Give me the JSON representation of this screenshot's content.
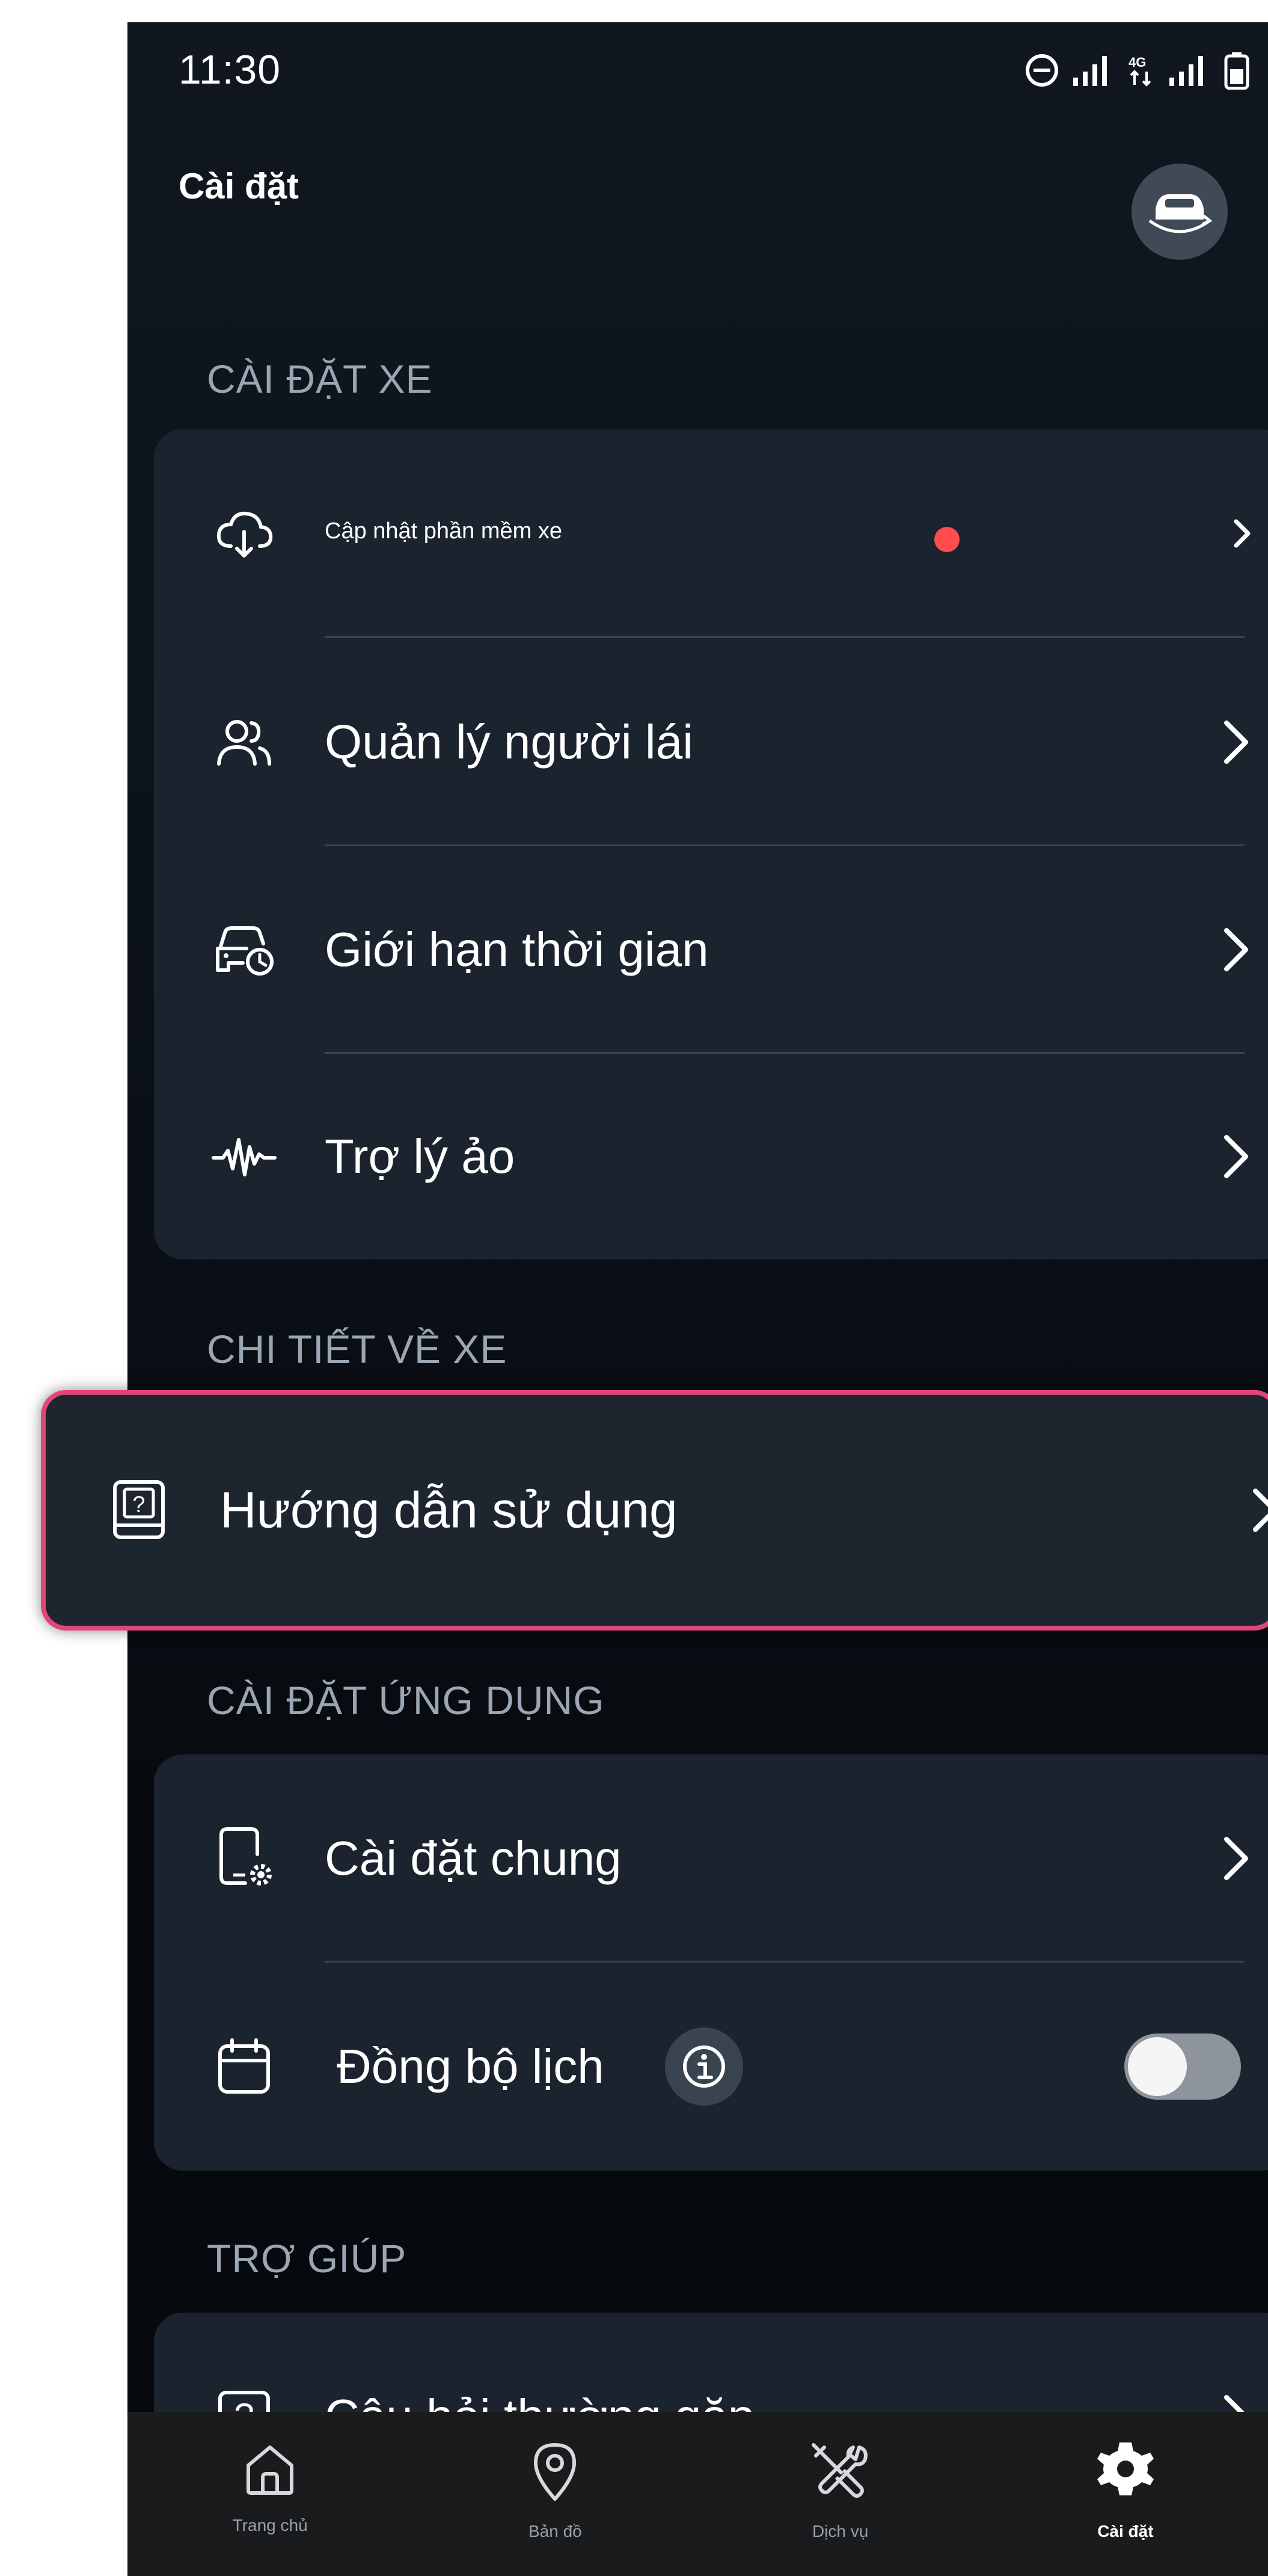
{
  "status_bar": {
    "time": "11:30",
    "signal_label": "4G"
  },
  "header": {
    "title": "Cài đặt"
  },
  "sections": {
    "vehicle_settings": {
      "label": "CÀI ĐẶT XE",
      "items": [
        {
          "label": "Cập nhật phần mềm xe",
          "icon": "cloud-download-icon"
        },
        {
          "label": "Quản lý người lái",
          "icon": "users-icon"
        },
        {
          "label": "Giới hạn thời gian",
          "icon": "car-clock-icon"
        },
        {
          "label": "Trợ lý ảo",
          "icon": "voice-wave-icon"
        }
      ]
    },
    "vehicle_details": {
      "label": "CHI TIẾT VỀ XE",
      "items": [
        {
          "label": "Hướng dẫn sử dụng",
          "icon": "manual-book-icon"
        }
      ]
    },
    "app_settings": {
      "label": "CÀI ĐẶT ỨNG DỤNG",
      "items": [
        {
          "label": "Cài đặt chung",
          "icon": "phone-settings-icon"
        },
        {
          "label": "Đồng bộ lịch",
          "icon": "calendar-icon",
          "toggle_on": false
        }
      ]
    },
    "help": {
      "label": "TRỢ GIÚP",
      "items": [
        {
          "label": "Câu hỏi thường gặp",
          "icon": "question-box-icon"
        }
      ]
    }
  },
  "bottom_nav": {
    "items": [
      {
        "label": "Trang chủ",
        "icon": "home-icon"
      },
      {
        "label": "Bản đồ",
        "icon": "map-pin-icon"
      },
      {
        "label": "Dịch vụ",
        "icon": "tools-icon"
      },
      {
        "label": "Cài đặt",
        "icon": "gear-icon",
        "active": true
      }
    ]
  },
  "colors": {
    "background": "#0c1219",
    "card": "#1b242e",
    "accent_highlight": "#e0457b",
    "notification_dot": "#ff4d4d"
  }
}
